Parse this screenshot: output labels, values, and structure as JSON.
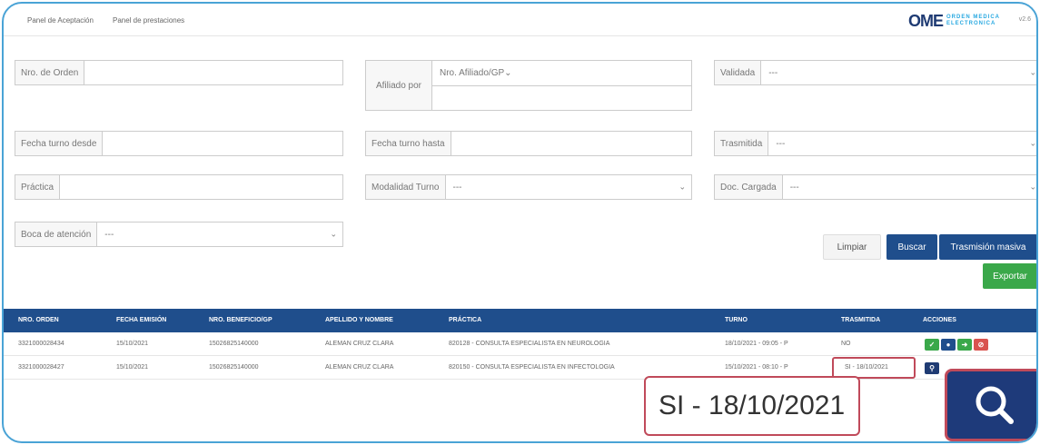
{
  "nav": {
    "panel_aceptacion": "Panel de Aceptación",
    "panel_prestaciones": "Panel de prestaciones"
  },
  "brand": {
    "logo": "OME",
    "line1": "ORDEN MEDICA",
    "line2": "ELECTRONICA",
    "version": "v2.6"
  },
  "filters": {
    "nro_orden": {
      "label": "Nro. de Orden",
      "value": ""
    },
    "afiliado": {
      "label": "Afiliado por",
      "select": "Nro. Afiliado/GP",
      "value": ""
    },
    "validada": {
      "label": "Validada",
      "value": "---"
    },
    "fecha_desde": {
      "label": "Fecha turno desde",
      "value": ""
    },
    "fecha_hasta": {
      "label": "Fecha turno hasta",
      "value": ""
    },
    "trasmitida": {
      "label": "Trasmitida",
      "value": "---"
    },
    "practica": {
      "label": "Práctica",
      "value": ""
    },
    "modalidad": {
      "label": "Modalidad Turno",
      "value": "---"
    },
    "doc_cargada": {
      "label": "Doc. Cargada",
      "value": "---"
    },
    "boca_atencion": {
      "label": "Boca de atención",
      "value": "---"
    }
  },
  "buttons": {
    "limpiar": "Limpiar",
    "buscar": "Buscar",
    "trasmision_masiva": "Trasmisión masiva",
    "exportar": "Exportar"
  },
  "table": {
    "headers": [
      "NRO. ORDEN",
      "FECHA EMISIÓN",
      "NRO. BENEFICIO/GP",
      "APELLIDO Y NOMBRE",
      "PRÁCTICA",
      "TURNO",
      "TRASMITIDA",
      "ACCIONES"
    ],
    "rows": [
      [
        "3321000028434",
        "15/10/2021",
        "15026825140000",
        "ALEMAN CRUZ CLARA",
        "820128 - CONSULTA ESPECIALISTA EN NEUROLOGIA",
        "18/10/2021 - 09:05 - P",
        "NO"
      ],
      [
        "3321000028427",
        "15/10/2021",
        "15026825140000",
        "ALEMAN CRUZ CLARA",
        "820150 - CONSULTA ESPECIALISTA EN INFECTOLOGIA",
        "15/10/2021 - 08:10 - P",
        "SI - 18/10/2021"
      ]
    ]
  },
  "callout": {
    "text": "SI - 18/10/2021"
  },
  "icons": {
    "validate": "check-icon",
    "user": "user-icon",
    "send": "arrow-right-icon",
    "cancel": "cancel-icon",
    "search": "search-icon"
  },
  "colors": {
    "header_blue": "#1f4e8c",
    "green": "#3aa84a",
    "red": "#d9534f",
    "highlight": "#c04a5a"
  }
}
